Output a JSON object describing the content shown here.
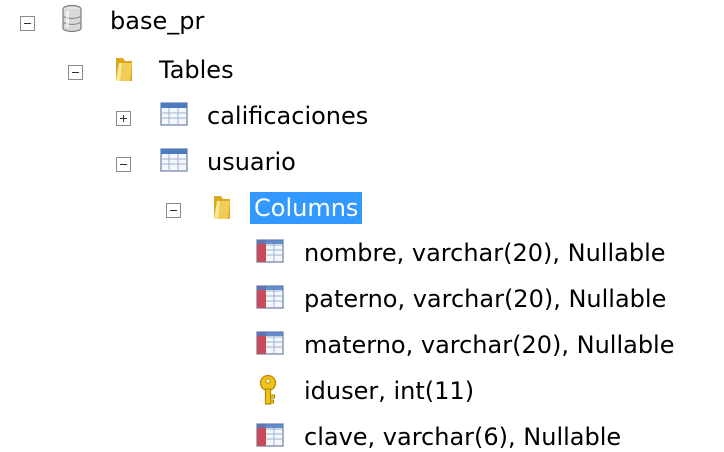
{
  "tree": {
    "database": {
      "label": "base_pr",
      "icon": "database-icon",
      "expanded": true
    },
    "tables_folder": {
      "label": "Tables",
      "icon": "folder-icon",
      "expanded": true
    },
    "tables": [
      {
        "label": "calificaciones",
        "icon": "table-icon",
        "expanded": false
      },
      {
        "label": "usuario",
        "icon": "table-icon",
        "expanded": true
      }
    ],
    "columns_folder": {
      "label": "Columns",
      "icon": "folder-icon",
      "expanded": true,
      "selected": true
    },
    "columns": [
      {
        "label": "nombre, varchar(20), Nullable",
        "icon": "column-icon"
      },
      {
        "label": "paterno, varchar(20), Nullable",
        "icon": "column-icon"
      },
      {
        "label": "materno, varchar(20), Nullable",
        "icon": "column-icon"
      },
      {
        "label": "iduser, int(11)",
        "icon": "key-icon"
      },
      {
        "label": "clave, varchar(6), Nullable",
        "icon": "column-icon"
      }
    ]
  },
  "colors": {
    "selection": "#3399ff",
    "folder": "#e9c13a",
    "table_header": "#4c7bbf",
    "key": "#f2c318"
  }
}
